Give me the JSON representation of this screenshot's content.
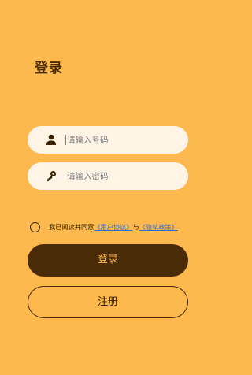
{
  "page": {
    "title": "登录"
  },
  "form": {
    "phone": {
      "placeholder": "请输入号码",
      "value": "",
      "icon": "user-icon"
    },
    "password": {
      "placeholder": "请输入密码",
      "value": "",
      "icon": "key-icon"
    }
  },
  "agreement": {
    "checked": false,
    "prefix": "我已阅读并同意",
    "user_agreement": "《用户协议》",
    "and": "与",
    "privacy_policy": "《隐私政策》"
  },
  "buttons": {
    "login": "登录",
    "register": "注册"
  },
  "colors": {
    "background": "#FDB84E",
    "primary_dark": "#4A2C08",
    "field_bg": "#FFF4E6",
    "link": "#2F6FCC"
  }
}
